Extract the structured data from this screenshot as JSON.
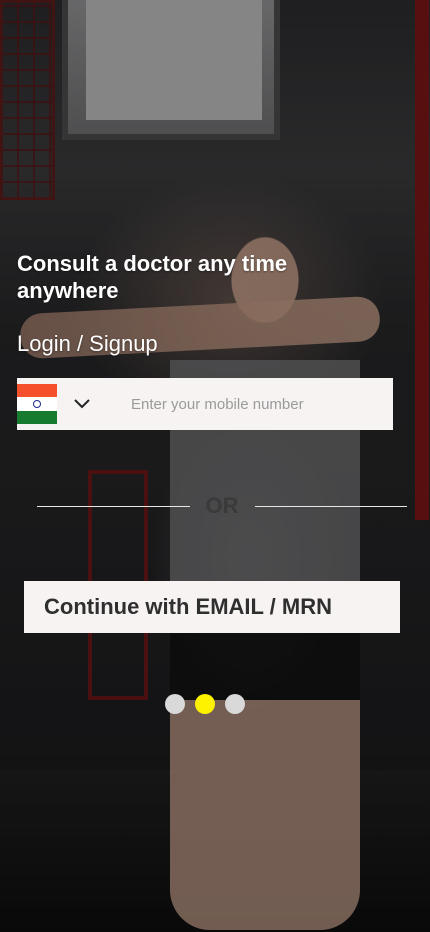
{
  "hero": {
    "headline": "Consult a doctor any time anywhere",
    "subhead": "Login / Signup"
  },
  "phone": {
    "country_flag": "india-flag-icon",
    "placeholder": "Enter your mobile number",
    "value": ""
  },
  "divider": {
    "label": "OR"
  },
  "email_button": {
    "label": "Continue with EMAIL / MRN"
  },
  "carousel": {
    "total": 3,
    "active_index": 1,
    "active_color": "#fff200",
    "inactive_color": "#d9d9d9"
  }
}
